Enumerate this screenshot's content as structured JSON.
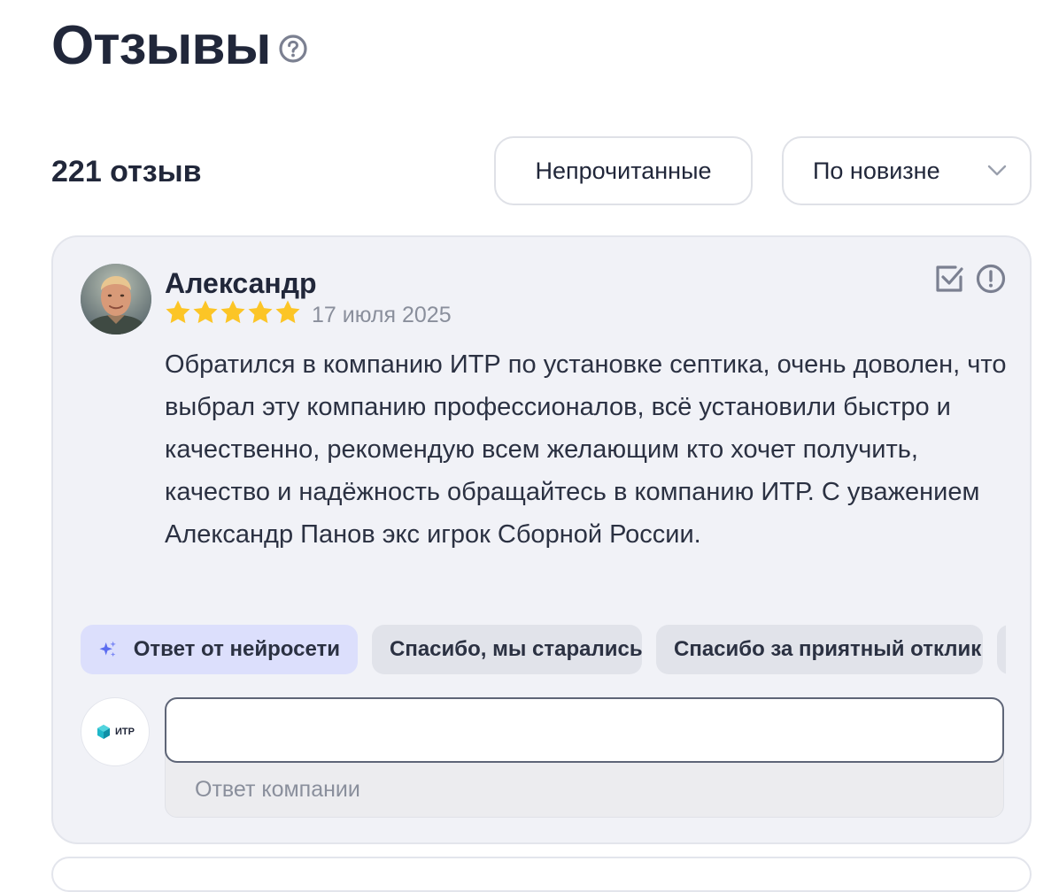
{
  "header": {
    "title": "Отзывы",
    "help_icon": "question-circle-icon"
  },
  "toolbar": {
    "count_label": "221 отзыв",
    "unread_label": "Непрочитанные",
    "sort_label": "По новизне",
    "sort_icon": "chevron-down-icon"
  },
  "review": {
    "author": "Александр",
    "rating": 5,
    "rating_max": 5,
    "date": "17 июля 2025",
    "text": "Обратился в компанию ИТР по установке септика, очень доволен, что выбрал эту компанию профессионалов, всё установили быстро и качественно, рекомендую всем желающим кто хочет получить, качество и надёжность обращайтесь в компанию ИТР. С уважением Александр Панов экс игрок Сборной России.",
    "actions": [
      "checkbox-mark-icon",
      "exclamation-circle-icon"
    ]
  },
  "quick_replies": {
    "ai_label": "Ответ от нейросети",
    "chip2": "Спасибо, мы старались",
    "chip3": "Спасибо за приятный отклик",
    "chip4": ""
  },
  "reply": {
    "company_logo_text": "ИТР",
    "placeholder": "Ответ компании"
  },
  "colors": {
    "text": "#21273a",
    "muted": "#8a8f9c",
    "star": "#fcc526",
    "ai_chip": "#dcdffc",
    "sparkle": "#5b6cf0",
    "card_bg": "#f1f2f7"
  }
}
